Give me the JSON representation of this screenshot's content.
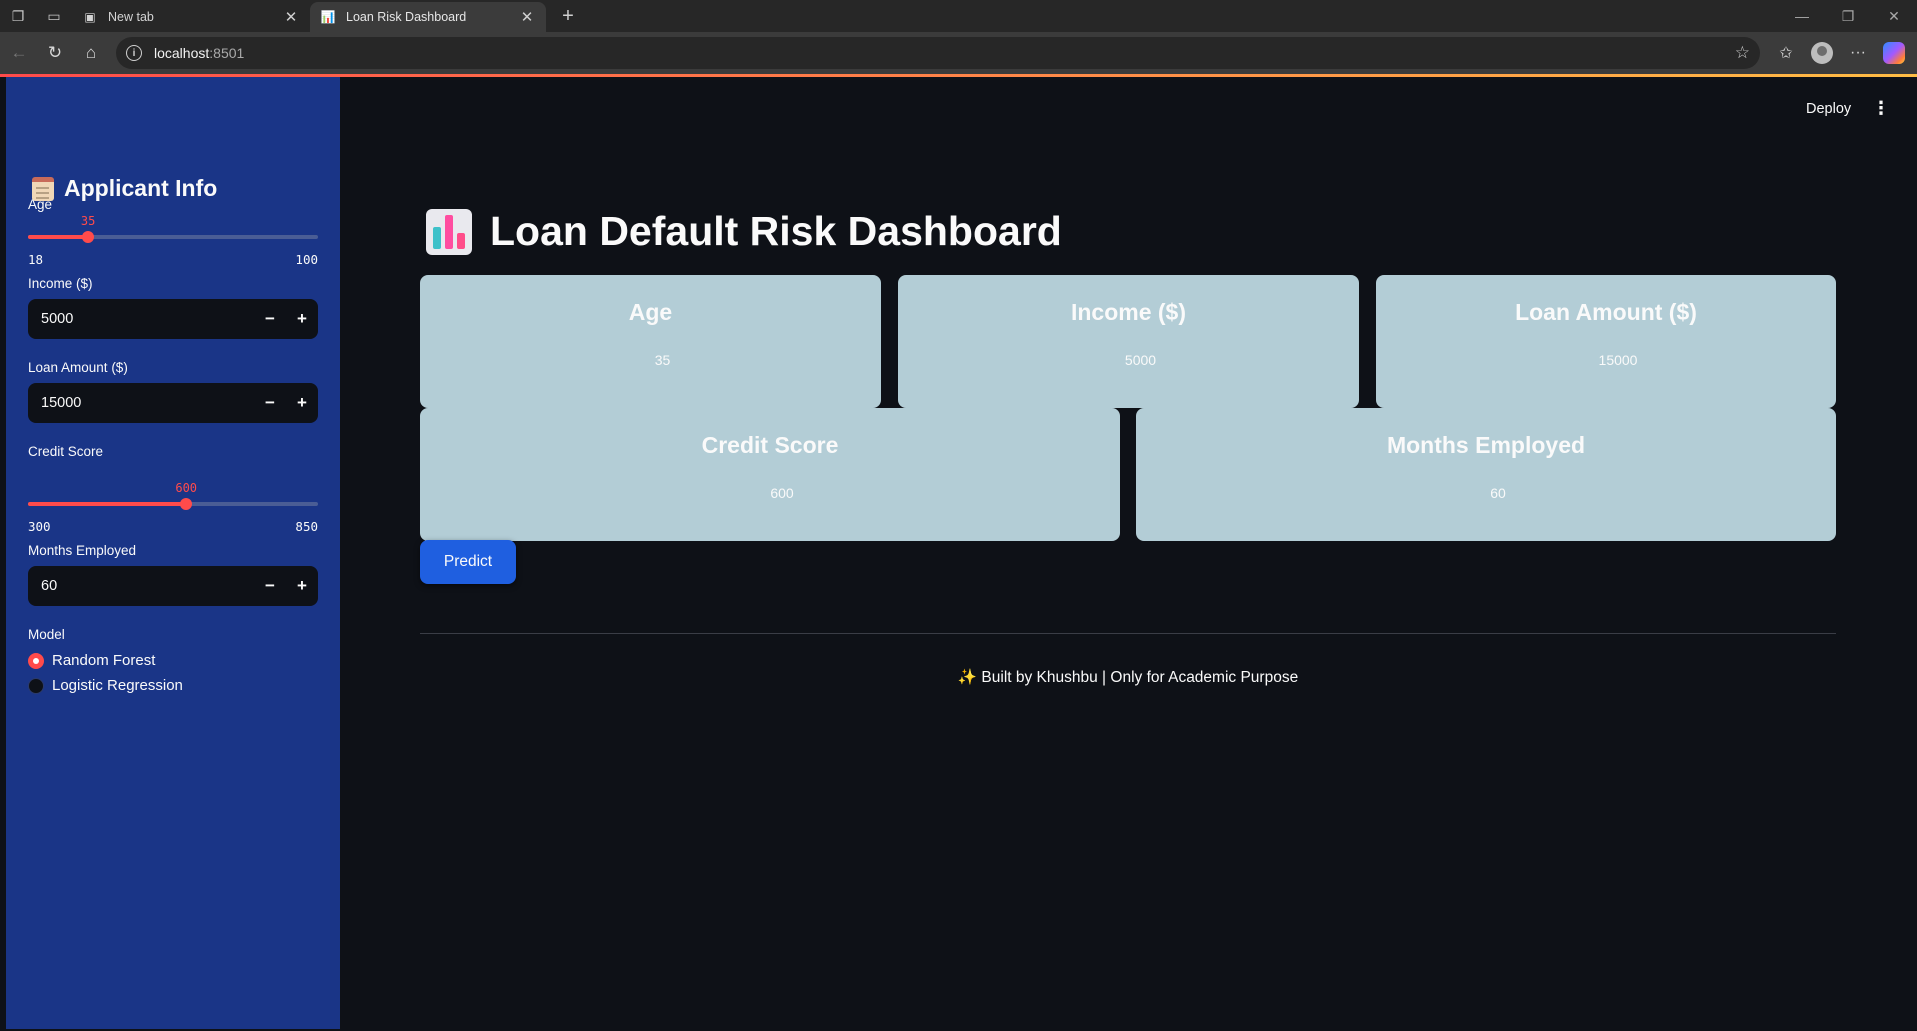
{
  "browser": {
    "tabs": [
      {
        "title": "New tab",
        "active": false
      },
      {
        "title": "Loan Risk Dashboard",
        "active": true
      }
    ],
    "url_host": "localhost",
    "url_port": ":8501"
  },
  "toolbar": {
    "deploy_label": "Deploy",
    "menu_icon": "kebab-menu-icon"
  },
  "sidebar": {
    "title": "Applicant Info",
    "title_icon": "clipboard-icon",
    "age": {
      "label": "Age",
      "value": "35",
      "min": "18",
      "max": "100",
      "fraction": 0.2073
    },
    "income": {
      "label": "Income ($)",
      "value": "5000"
    },
    "loan_amount": {
      "label": "Loan Amount ($)",
      "value": "15000"
    },
    "credit_score": {
      "label": "Credit Score",
      "value": "600",
      "min": "300",
      "max": "850",
      "fraction": 0.5455
    },
    "months_employed": {
      "label": "Months Employed",
      "value": "60"
    },
    "model": {
      "label": "Model",
      "options": [
        "Random Forest",
        "Logistic Regression"
      ],
      "selected": "Random Forest"
    }
  },
  "main": {
    "title": "Loan Default Risk Dashboard",
    "title_icon": "bar-chart-icon",
    "cards": [
      {
        "title": "Age",
        "value": "35"
      },
      {
        "title": "Income ($)",
        "value": "5000"
      },
      {
        "title": "Loan Amount ($)",
        "value": "15000"
      },
      {
        "title": "Credit Score",
        "value": "600"
      },
      {
        "title": "Months Employed",
        "value": "60"
      }
    ],
    "predict_label": "Predict",
    "footer_icon": "✨",
    "footer": "Built by Khushbu | Only for Academic Purpose"
  },
  "colors": {
    "sidebar_bg": "#1a3587",
    "main_bg": "#0e1117",
    "card_bg": "#b3cdd6",
    "accent": "#ff4b4b",
    "button": "#1f5fe0"
  }
}
